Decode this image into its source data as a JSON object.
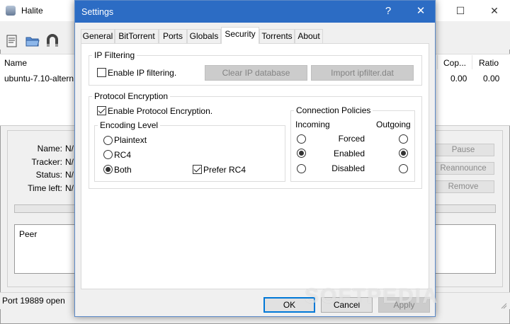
{
  "bg": {
    "title": "Halite",
    "controls": {
      "maximize": "☐",
      "close": "✕"
    },
    "columns": [
      "Name",
      "Cop...",
      "Ratio"
    ],
    "row": {
      "name": "ubuntu-7.10-altern",
      "copies": "0.00",
      "ratio": "0.00"
    },
    "details": {
      "name_label": "Name:",
      "name_value": "N/",
      "tracker_label": "Tracker:",
      "tracker_value": "N/",
      "status_label": "Status:",
      "status_value": "N/",
      "time_label": "Time left:",
      "time_value": "N/"
    },
    "buttons": {
      "pause": "Pause",
      "reannounce": "Reannounce",
      "remove": "Remove"
    },
    "peer_header": "Peer",
    "status_bar": "Port 19889 open",
    "toolbar_icons": [
      "open-torrent-icon",
      "folder-icon",
      "magnet-icon"
    ]
  },
  "dialog": {
    "title": "Settings",
    "help": "?",
    "close": "✕",
    "tabs": [
      "General",
      "BitTorrent",
      "Ports",
      "Globals",
      "Security",
      "Torrents",
      "About"
    ],
    "active_tab": "Security",
    "ip_filtering": {
      "legend": "IP Filtering",
      "enable_label": "Enable IP filtering.",
      "enable_checked": false,
      "clear_button": "Clear IP database",
      "import_button": "Import ipfilter.dat"
    },
    "protocol_encryption": {
      "legend": "Protocol Encryption",
      "enable_label": "Enable Protocol Encryption.",
      "enable_checked": true,
      "encoding_level": {
        "legend": "Encoding Level",
        "options": [
          "Plaintext",
          "RC4",
          "Both"
        ],
        "selected": "Both",
        "prefer_rc4_label": "Prefer RC4",
        "prefer_rc4_checked": true
      },
      "connection_policies": {
        "legend": "Connection Policies",
        "incoming_label": "Incoming",
        "outgoing_label": "Outgoing",
        "rows": [
          "Forced",
          "Enabled",
          "Disabled"
        ],
        "incoming_selected": "Enabled",
        "outgoing_selected": "Enabled"
      }
    },
    "buttons": {
      "ok": "OK",
      "cancel": "Cancel",
      "apply": "Apply"
    }
  },
  "watermark": "SOFTPEDIA"
}
